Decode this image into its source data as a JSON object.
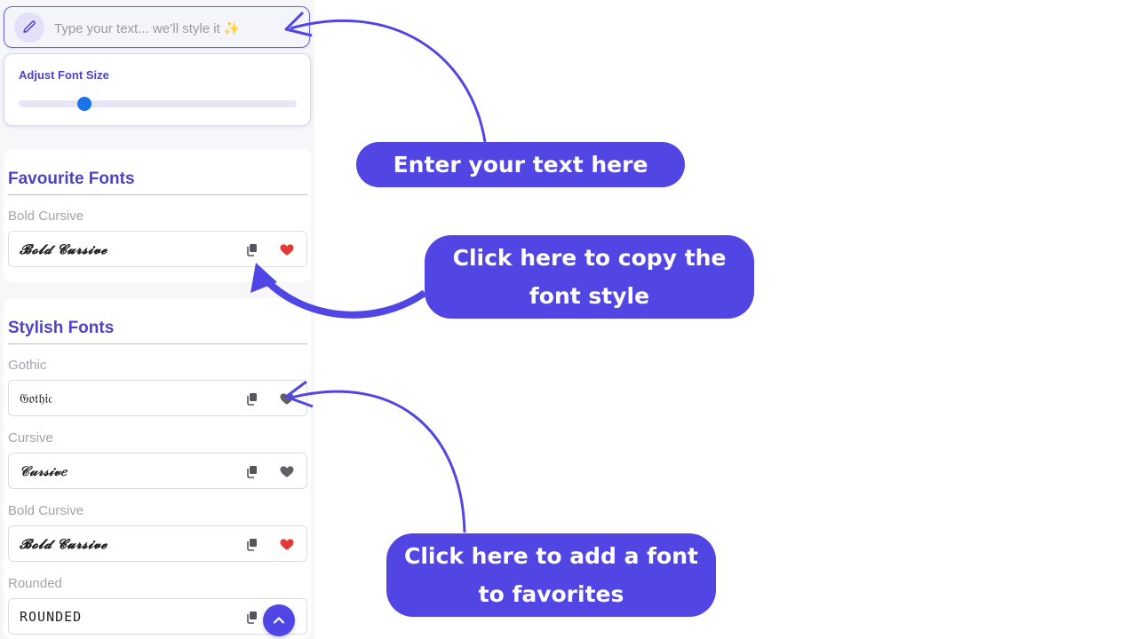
{
  "input": {
    "placeholder": "Type your text... we’ll style it ✨"
  },
  "font_size": {
    "title": "Adjust Font Size",
    "slider_value_fraction": 0.237
  },
  "favourite_section": {
    "title": "Favourite Fonts",
    "fonts": [
      {
        "label": "Bold Cursive",
        "sample": "𝓑𝓸𝓵𝓭 𝓒𝓾𝓻𝓼𝓲𝓿𝓮",
        "favorited": true
      }
    ]
  },
  "stylish_section": {
    "title": "Stylish Fonts",
    "fonts": [
      {
        "label": "Gothic",
        "sample": "𝔊𝔬𝔱𝔥𝔦𝔠",
        "favorited": false
      },
      {
        "label": "Cursive",
        "sample": "𝒞𝓊𝓇𝓈𝒾𝓋𝑒",
        "favorited": false
      },
      {
        "label": "Bold Cursive",
        "sample": "𝓑𝓸𝓵𝓭 𝓒𝓾𝓻𝓼𝓲𝓿𝓮",
        "favorited": true
      },
      {
        "label": "Rounded",
        "sample": "ROUNDED",
        "favorited": false
      }
    ]
  },
  "callouts": {
    "enter_text": "Enter your text here",
    "copy_line1": "Click here to copy the",
    "copy_line2": "font style",
    "favorite_line1": "Click here to add a font",
    "favorite_line2": "to favorites"
  },
  "colors": {
    "accent": "#4f46e5",
    "callout_bg": "#5146e4",
    "heart_active": "#e53935",
    "heart_inactive": "#5f5f66",
    "slider_thumb": "#1a73e8"
  },
  "icons": {
    "input": "pencil-icon",
    "copy": "copy-icon",
    "favorite": "heart-icon",
    "scroll": "chevron-up-icon"
  }
}
